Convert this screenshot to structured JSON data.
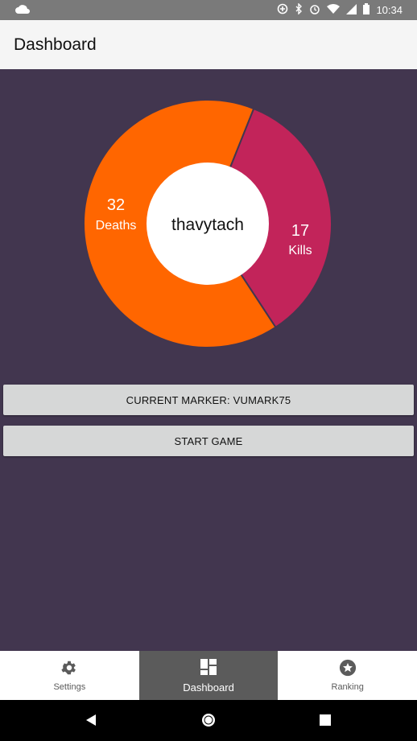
{
  "status_bar": {
    "time": "10:34"
  },
  "app_bar": {
    "title": "Dashboard"
  },
  "chart_data": {
    "type": "pie",
    "center_label": "thavytach",
    "slices": [
      {
        "label": "Deaths",
        "value": 32,
        "color": "#ff6600"
      },
      {
        "label": "Kills",
        "value": 17,
        "color": "#c2245a"
      }
    ]
  },
  "buttons": {
    "current_marker": "CURRENT MARKER: VUMARK75",
    "start_game": "START GAME"
  },
  "bottom_nav": {
    "items": [
      {
        "label": "Settings",
        "icon": "gear-icon",
        "active": false
      },
      {
        "label": "Dashboard",
        "icon": "dashboard-icon",
        "active": true
      },
      {
        "label": "Ranking",
        "icon": "star-icon",
        "active": false
      }
    ]
  },
  "colors": {
    "background": "#42364f",
    "deaths": "#ff6600",
    "kills": "#c2245a",
    "nav_active": "#5b5b5b"
  }
}
